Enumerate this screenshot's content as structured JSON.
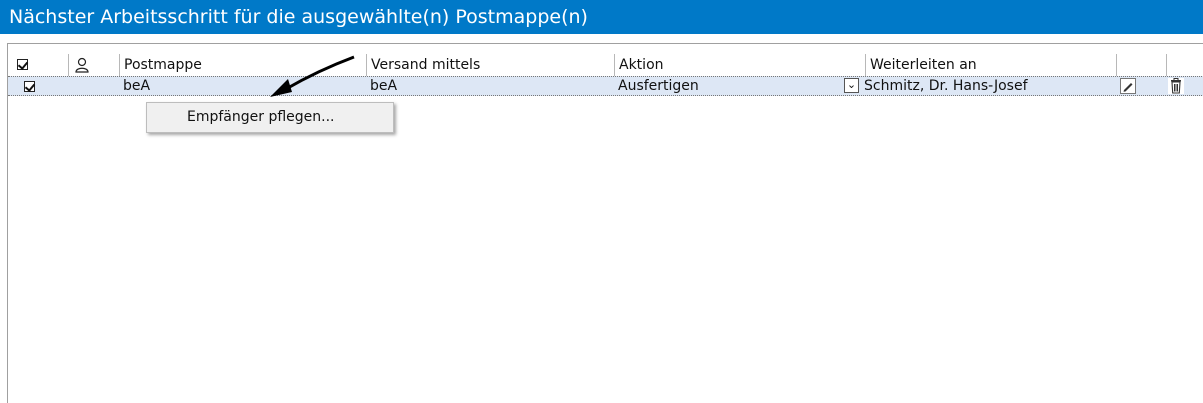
{
  "window": {
    "title": "Nächster Arbeitsschritt für die ausgewählte(n) Postmappe(n)"
  },
  "columns": {
    "select_icon": "checkbox-checked-icon",
    "recipient_icon": "person-icon",
    "postmappe": "Postmappe",
    "versand": "Versand mittels",
    "aktion": "Aktion",
    "weiterleiten": "Weiterleiten an"
  },
  "rows": [
    {
      "checked": true,
      "postmappe": "beA",
      "versand": "beA",
      "aktion": "Ausfertigen",
      "weiterleiten": "Schmitz, Dr. Hans-Josef",
      "edit_icon": "pencil-icon",
      "delete_icon": "trash-icon"
    }
  ],
  "context_menu": {
    "items": [
      "Empfänger pflegen..."
    ]
  },
  "colors": {
    "title_bg": "#0079c8",
    "row_highlight": "#dde7f5",
    "menu_bg": "#f0f0f0"
  }
}
